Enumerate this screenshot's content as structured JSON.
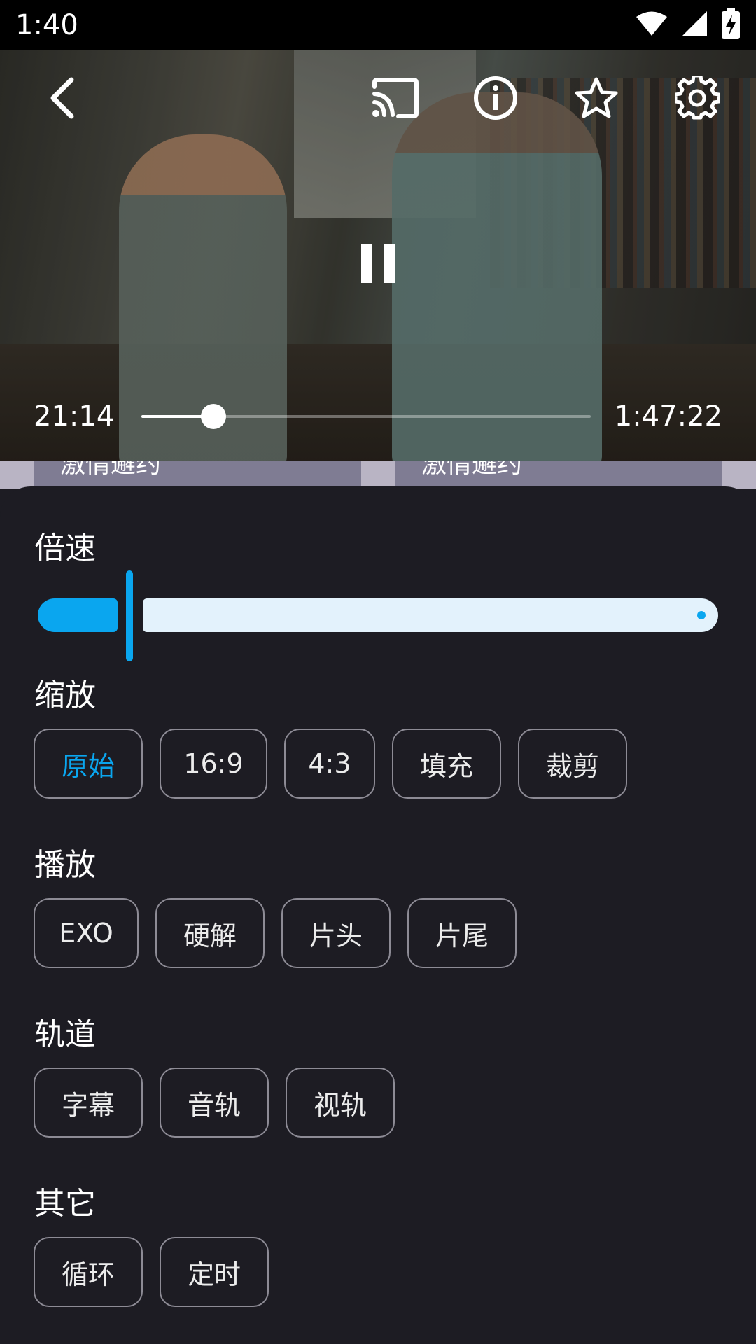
{
  "status_bar": {
    "time": "1:40"
  },
  "player": {
    "current_time": "21:14",
    "total_time": "1:47:22",
    "progress_fraction": 0.16
  },
  "background_list": {
    "items": [
      "激情邂约",
      "激情邂约"
    ]
  },
  "settings_sheet": {
    "speed": {
      "title": "倍速",
      "level_fraction": 0.13
    },
    "zoom": {
      "title": "缩放",
      "options": [
        "原始",
        "16:9",
        "4:3",
        "填充",
        "裁剪"
      ],
      "selected": "原始"
    },
    "playback": {
      "title": "播放",
      "options": [
        "EXO",
        "硬解",
        "片头",
        "片尾"
      ]
    },
    "tracks": {
      "title": "轨道",
      "options": [
        "字幕",
        "音轨",
        "视轨"
      ]
    },
    "other": {
      "title": "其它",
      "options": [
        "循环",
        "定时"
      ]
    }
  },
  "colors": {
    "accent": "#0aa6ef",
    "sheet_bg": "#1d1c23",
    "chip_border": "#8d8b95",
    "slider_track": "#e3f2fc"
  },
  "icons": [
    "back-icon",
    "cast-icon",
    "info-icon",
    "star-icon",
    "settings-icon",
    "pause-icon",
    "wifi-icon",
    "signal-icon",
    "battery-charging-icon"
  ]
}
